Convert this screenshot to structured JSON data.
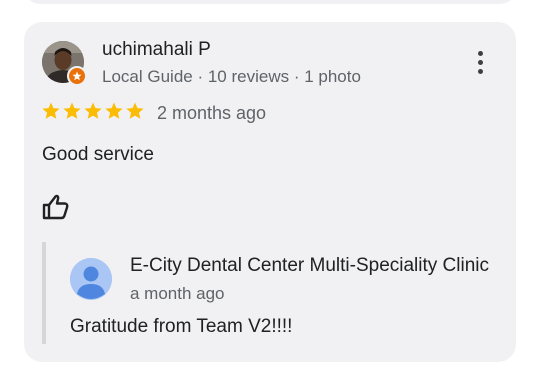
{
  "review": {
    "reviewer_name": "uchimahali P",
    "reviewer_meta": "Local Guide · 10 reviews · 1 photo",
    "rating": 5,
    "rating_max": 5,
    "date": "2 months ago",
    "text": "Good service"
  },
  "owner_response": {
    "name": "E-City Dental Center Multi-Speciality Clinic",
    "date": "a month ago",
    "text": "Gratitude from Team V2!!!!"
  },
  "icons": {
    "more": "more-vert-icon",
    "like": "thumb-up-icon",
    "star": "star-icon",
    "badge": "local-guide-badge-icon"
  },
  "colors": {
    "card_background": "#f1f1f3",
    "star": "#fbbc04",
    "local_guide_badge": "#e8710a",
    "owner_avatar": "#a9c6f5",
    "primary_text": "#202124",
    "secondary_text": "#5f6368"
  }
}
